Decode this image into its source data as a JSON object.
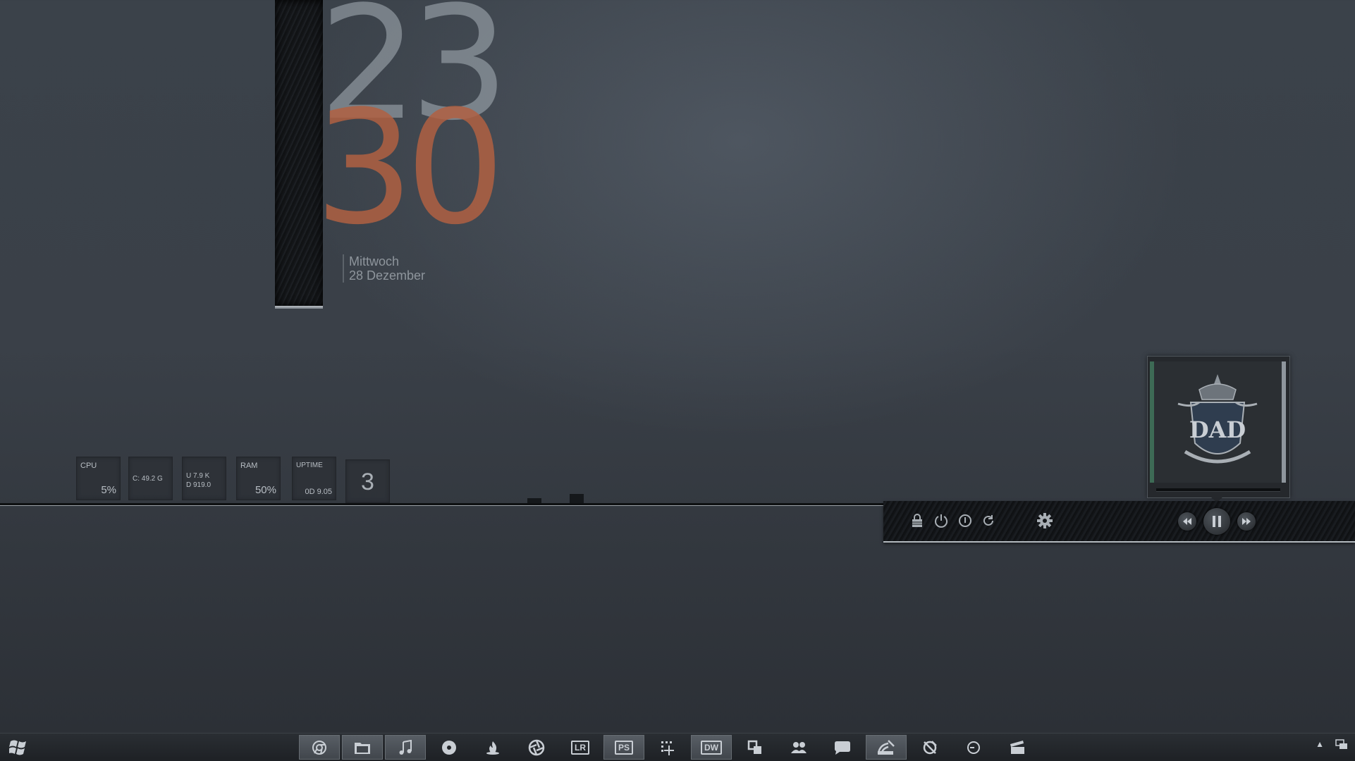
{
  "clock": {
    "hour": "23",
    "minute": "30"
  },
  "date": {
    "weekday": "Mittwoch",
    "day_month": "28 Dezember"
  },
  "stats": {
    "cpu_label": "CPU",
    "cpu_value": "5%",
    "disk_text": "C: 49.2 G",
    "net_up": "U 7.9 K",
    "net_down": "D 919.0",
    "ram_label": "RAM",
    "ram_value": "50%",
    "uptime_label": "UPTIME",
    "uptime_value": "0D 9.05",
    "counter": "3"
  },
  "control_panel": {
    "icons": [
      "lock-icon",
      "power-icon",
      "info-icon",
      "refresh-icon",
      "gear-icon"
    ],
    "media": [
      "previous-icon",
      "pause-icon",
      "next-icon"
    ]
  },
  "album": {
    "art_text": "DAD"
  },
  "taskbar": {
    "apps": [
      {
        "icon": "chrome-icon",
        "active": true
      },
      {
        "icon": "folder-icon",
        "active": true
      },
      {
        "icon": "music-note-icon",
        "active": true
      },
      {
        "icon": "disc-icon",
        "active": false
      },
      {
        "icon": "burn-icon",
        "active": false
      },
      {
        "icon": "aperture-icon",
        "active": false
      },
      {
        "icon": "lightroom-icon",
        "text": "LR",
        "active": false
      },
      {
        "icon": "photoshop-icon",
        "text": "PS",
        "active": true
      },
      {
        "icon": "snipping-icon",
        "active": false
      },
      {
        "icon": "dreamweaver-icon",
        "text": "DW",
        "active": true
      },
      {
        "icon": "window-switch-icon",
        "active": false
      },
      {
        "icon": "users-icon",
        "active": false
      },
      {
        "icon": "chat-bubble-icon",
        "active": false
      },
      {
        "icon": "satellite-icon",
        "active": true
      },
      {
        "icon": "no-sign-icon",
        "active": false
      },
      {
        "icon": "clock-icon",
        "active": false
      },
      {
        "icon": "clapper-icon",
        "active": false
      }
    ]
  },
  "colors": {
    "minute": "#b06042",
    "accent_green": "#3d6a55"
  }
}
